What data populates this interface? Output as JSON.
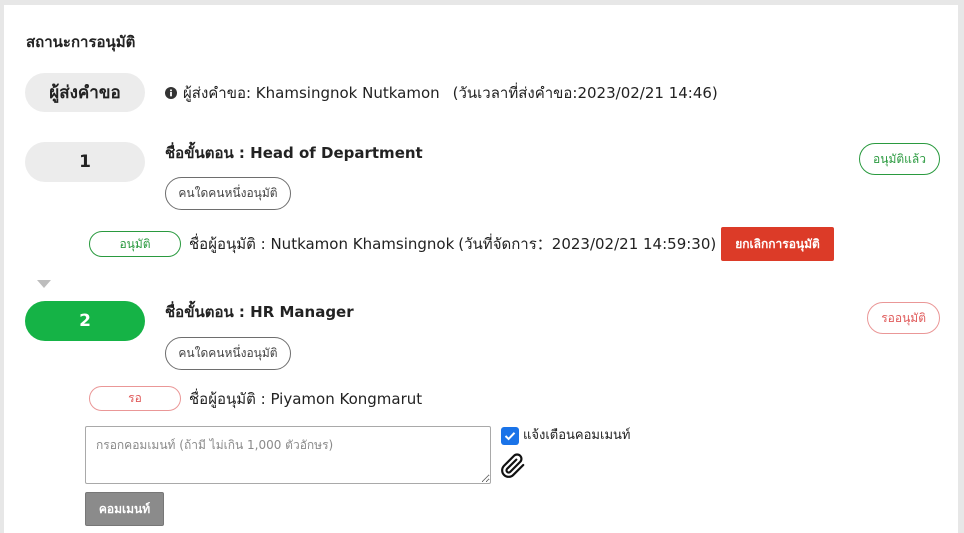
{
  "section_title": "สถานะการอนุมัติ",
  "requester": {
    "pill_label": "ผู้ส่งคำขอ",
    "icon": "info-circle-icon",
    "name_text": "ผู้ส่งคำขอ: Khamsingnok Nutkamon",
    "datetime_text": "(วันเวลาที่ส่งคำขอ:2023/02/21 14:46)"
  },
  "steps": [
    {
      "number": "1",
      "active": false,
      "title": "ชื่อขั้นตอน : Head of Department",
      "rule": "คนใดคนหนึ่งอนุมัติ",
      "status_badge": "อนุมัติแล้ว",
      "approver": {
        "status": "อนุมัติ",
        "name_text": "ชื่อผู้อนุมัติ : Nutkamon Khamsingnok",
        "handled_text": "(วันที่จัดการ：2023/02/21 14:59:30)",
        "cancel_label": "ยกเลิกการอนุมัติ"
      }
    },
    {
      "number": "2",
      "active": true,
      "title": "ชื่อขั้นตอน : HR Manager",
      "rule": "คนใดคนหนึ่งอนุมัติ",
      "status_badge": "รออนุมัติ",
      "approver": {
        "status": "รอ",
        "name_text": "ชื่อผู้อนุมัติ : Piyamon Kongmarut"
      }
    }
  ],
  "icons": {
    "step_divider": "triangle-down-icon"
  },
  "comment": {
    "placeholder": "กรอกคอมเมนท์ (ถ้ามี ไม่เกิน 1,000 ตัวอักษร)",
    "notify_label": "แจ้งเตือนคอมเมนท์",
    "notify_checked": true,
    "attach_icon": "paperclip-icon",
    "submit_label": "คอมเมนท์"
  },
  "colors": {
    "approved_green": "#2a9a3f",
    "active_step_green": "#15b346",
    "pending_red": "#e05a5a",
    "cancel_red": "#dc3b28",
    "step_gray": "#ececec",
    "comment_button_gray": "#8b8b8b",
    "checkbox_blue": "#1a73e8"
  }
}
